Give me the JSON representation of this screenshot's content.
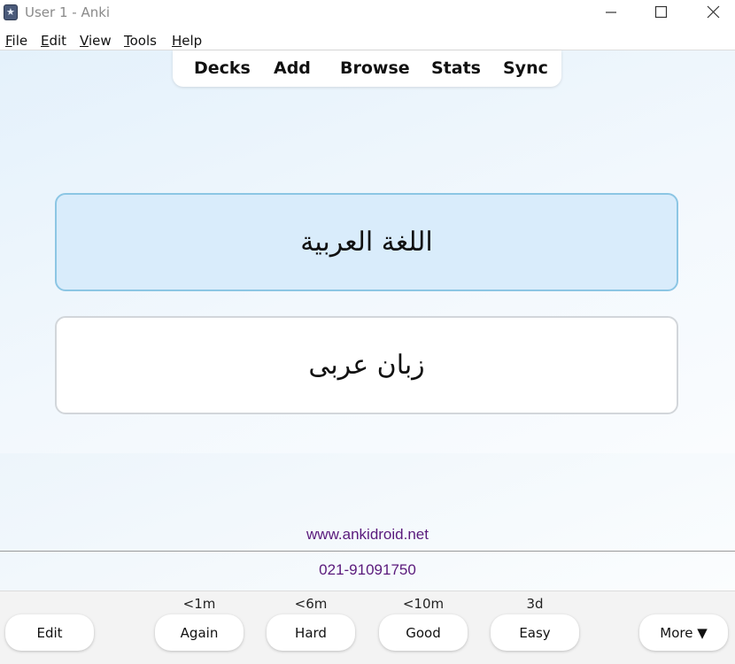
{
  "window": {
    "title": "User 1 - Anki",
    "app_icon": "anki-star-icon"
  },
  "menu": {
    "items": [
      {
        "label": "File",
        "mnemonic": "F",
        "rest": "ile"
      },
      {
        "label": "Edit",
        "mnemonic": "E",
        "rest": "dit"
      },
      {
        "label": "View",
        "mnemonic": "V",
        "rest": "iew"
      },
      {
        "label": "Tools",
        "mnemonic": "T",
        "rest": "ools"
      },
      {
        "label": "Help",
        "mnemonic": "H",
        "rest": "elp"
      }
    ]
  },
  "topnav": {
    "items": [
      "Decks",
      "Add",
      "Browse",
      "Stats",
      "Sync"
    ]
  },
  "card": {
    "front": "اللغة العربية",
    "back": "زبان عربی"
  },
  "footer_info": {
    "url": "www.ankidroid.net",
    "phone": "021-91091750"
  },
  "bottombar": {
    "edit_label": "Edit",
    "more_label": "More ▼",
    "answers": [
      {
        "interval": "<1m",
        "label": "Again"
      },
      {
        "interval": "<6m",
        "label": "Hard"
      },
      {
        "interval": "<10m",
        "label": "Good"
      },
      {
        "interval": "3d",
        "label": "Easy"
      }
    ]
  },
  "colors": {
    "card_front_bg": "#d9ecfb",
    "card_front_border": "#8cc6e4",
    "link_purple": "#5a1a7c"
  }
}
